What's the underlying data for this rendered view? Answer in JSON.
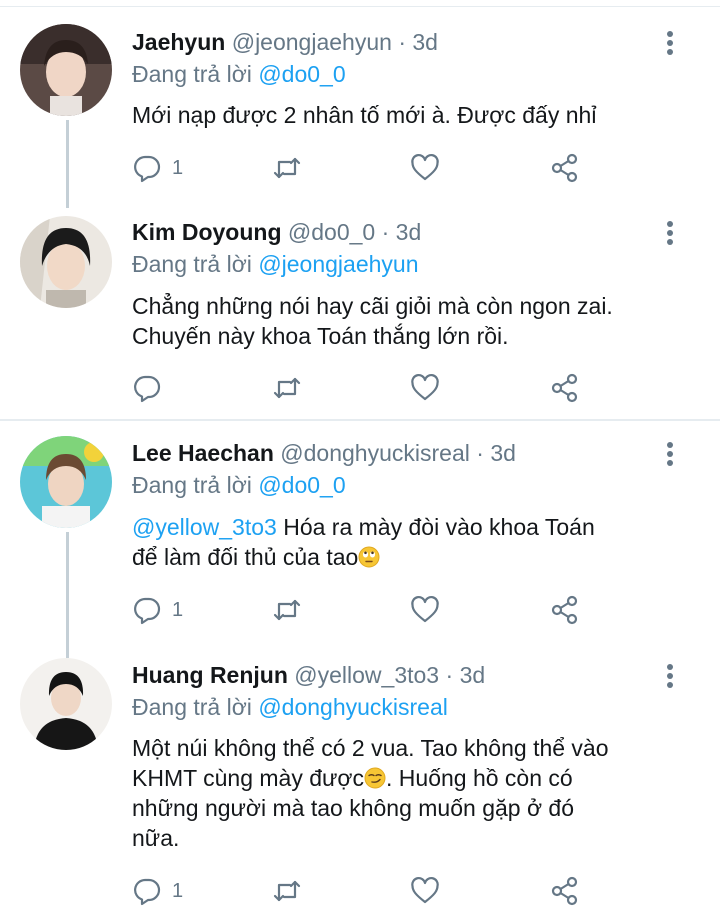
{
  "tweets": [
    {
      "name": "Jaehyun",
      "handle": "@jeongjaehyun",
      "dot": "·",
      "time": "3d",
      "reply_prefix": "Đang trả lời",
      "reply_to": "@do0_0",
      "text": "Mới nạp được 2 nhân tố mới à. Được đấy nhỉ",
      "reply_count": "1",
      "avatar_icon": "avatar-photo"
    },
    {
      "name": "Kim Doyoung",
      "handle": "@do0_0",
      "dot": "·",
      "time": "3d",
      "reply_prefix": "Đang trả lời",
      "reply_to": "@jeongjaehyun",
      "text_line1": "Chẳng những nói hay cãi giỏi mà còn ngon zai.",
      "text_line2": "Chuyến này khoa Toán thắng lớn rồi.",
      "reply_count": "",
      "avatar_icon": "avatar-photo"
    },
    {
      "name": "Lee Haechan",
      "handle": "@donghyuckisreal",
      "dot": "·",
      "time": "3d",
      "reply_prefix": "Đang trả lời",
      "reply_to": "@do0_0",
      "mention": "@yellow_3to3",
      "text_line1": " Hóa ra mày đòi vào khoa Toán",
      "text_line2": "để làm đối thủ của tao",
      "emoji": "rolling-eyes-emoji",
      "reply_count": "1",
      "avatar_icon": "avatar-photo"
    },
    {
      "name": "Huang Renjun",
      "handle": "@yellow_3to3",
      "dot": "·",
      "time": "3d",
      "reply_prefix": "Đang trả lời",
      "reply_to": "@donghyuckisreal",
      "text_line1": "Một núi không thể có 2 vua. Tao không thể vào",
      "text_line2a": "KHMT cùng mày được",
      "text_line2b": ". Huống hồ còn có",
      "text_line3": "những người mà tao không muốn gặp ở đó",
      "text_line4": "nữa.",
      "emoji": "smirk-emoji",
      "reply_count": "1",
      "avatar_icon": "avatar-photo"
    }
  ],
  "icons": {
    "reply": "reply-icon",
    "retweet": "retweet-icon",
    "like": "heart-icon",
    "share": "share-icon",
    "more": "more-vertical-icon"
  },
  "colors": {
    "link": "#1da1f2",
    "secondary": "#657786",
    "divider": "#e6ecf0",
    "thread_line": "#c4cfd6"
  }
}
